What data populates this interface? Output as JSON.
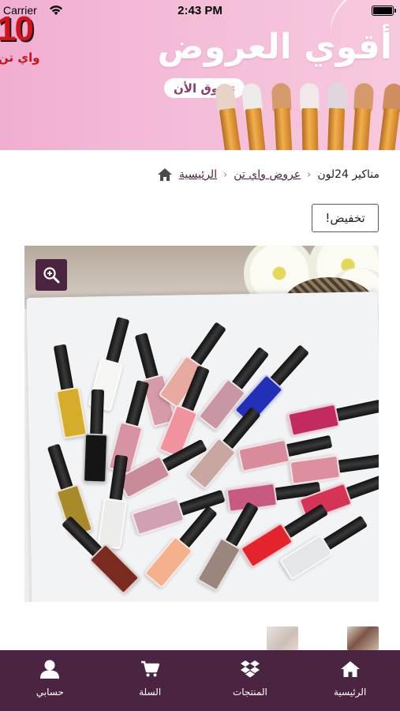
{
  "status_bar": {
    "carrier": "Carrier",
    "time": "2:43 PM"
  },
  "banner": {
    "promo_number": "10",
    "promo_brand": "واي تن",
    "title": "أقوي العروض",
    "cta_label": "تسوق الأن"
  },
  "breadcrumb": {
    "home": "الرئيسية",
    "category": "عروض واي تن",
    "current": "مناكير 24لون"
  },
  "product": {
    "sale_badge": "تخفيض!"
  },
  "tab_bar": {
    "items": [
      {
        "label": "الرئيسية",
        "icon": "home-icon"
      },
      {
        "label": "المنتجات",
        "icon": "products-icon"
      },
      {
        "label": "السلة",
        "icon": "cart-icon"
      },
      {
        "label": "حسابي",
        "icon": "account-icon"
      }
    ]
  },
  "colors": {
    "brand": "#4a2440",
    "banner_pink": "#f3b7d4",
    "cta_text": "#8d3a68",
    "promo_red": "#d4121b"
  }
}
